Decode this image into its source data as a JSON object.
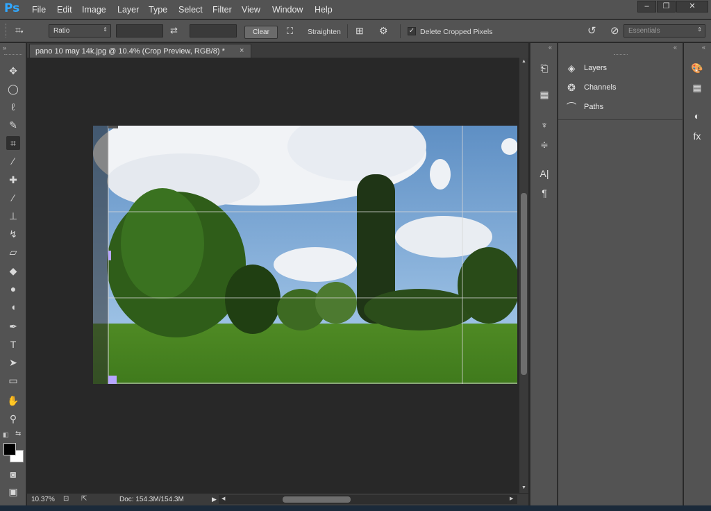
{
  "app": {
    "logo": "Ps"
  },
  "menu": [
    "File",
    "Edit",
    "Image",
    "Layer",
    "Type",
    "Select",
    "Filter",
    "View",
    "Window",
    "Help"
  ],
  "window_controls": {
    "minimize": "‒",
    "restore": "❐",
    "close": "✕"
  },
  "options": {
    "ratio_label": "Ratio",
    "width_value": "",
    "height_value": "",
    "clear_label": "Clear",
    "straighten_label": "Straighten",
    "delete_cropped_label": "Delete Cropped Pixels",
    "delete_cropped_checked": true,
    "workspace_label": "Essentials"
  },
  "document": {
    "tab_title": "pano 10 may 14k.jpg @ 10.4% (Crop Preview, RGB/8) *",
    "close": "×"
  },
  "status": {
    "zoom": "10.37%",
    "doc_info": "Doc: 154.3M/154.3M"
  },
  "panels": {
    "layers": "Layers",
    "channels": "Channels",
    "paths": "Paths"
  },
  "colors": {
    "accent": "#31a8ff",
    "chrome": "#535353",
    "canvas_bg": "#282828"
  }
}
